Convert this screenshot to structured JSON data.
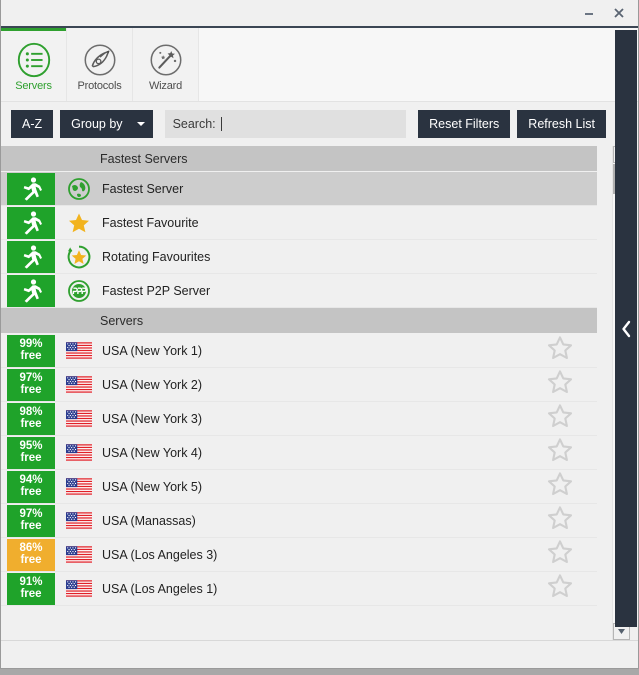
{
  "window": {
    "minimize_label": "minimize-button",
    "close_label": "close-button"
  },
  "tabs": [
    {
      "label": "Servers",
      "icon": "list-circle-icon",
      "active": true
    },
    {
      "label": "Protocols",
      "icon": "protocols-icon",
      "active": false
    },
    {
      "label": "Wizard",
      "icon": "magic-wand-icon",
      "active": false
    }
  ],
  "toolbar": {
    "sort_label": "A-Z",
    "groupby_label": "Group by",
    "search_label": "Search:",
    "search_value": "",
    "search_placeholder": "Search:",
    "reset_label": "Reset Filters",
    "refresh_label": "Refresh List"
  },
  "sections": [
    {
      "header": "Fastest Servers",
      "rows": [
        {
          "badge": "run",
          "badge_color": "green",
          "icon": "globe-icon",
          "label": "Fastest Server",
          "selected": true,
          "star": false
        },
        {
          "badge": "run",
          "badge_color": "green",
          "icon": "star-filled-icon",
          "label": "Fastest Favourite",
          "selected": false,
          "star": false
        },
        {
          "badge": "run",
          "badge_color": "green",
          "icon": "rotating-star-icon",
          "label": "Rotating Favourites",
          "selected": false,
          "star": false
        },
        {
          "badge": "run",
          "badge_color": "green",
          "icon": "p2p-icon",
          "label": "Fastest P2P Server",
          "selected": false,
          "star": false
        }
      ]
    },
    {
      "header": "Servers",
      "rows": [
        {
          "pct": "99%",
          "free": "free",
          "badge_color": "green",
          "icon": "flag-usa-icon",
          "label": "USA (New York 1)",
          "selected": false,
          "star": true
        },
        {
          "pct": "97%",
          "free": "free",
          "badge_color": "green",
          "icon": "flag-usa-icon",
          "label": "USA (New York 2)",
          "selected": false,
          "star": true
        },
        {
          "pct": "98%",
          "free": "free",
          "badge_color": "green",
          "icon": "flag-usa-icon",
          "label": "USA (New York 3)",
          "selected": false,
          "star": true
        },
        {
          "pct": "95%",
          "free": "free",
          "badge_color": "green",
          "icon": "flag-usa-icon",
          "label": "USA (New York 4)",
          "selected": false,
          "star": true
        },
        {
          "pct": "94%",
          "free": "free",
          "badge_color": "green",
          "icon": "flag-usa-icon",
          "label": "USA (New York 5)",
          "selected": false,
          "star": true
        },
        {
          "pct": "97%",
          "free": "free",
          "badge_color": "green",
          "icon": "flag-usa-icon",
          "label": "USA (Manassas)",
          "selected": false,
          "star": true
        },
        {
          "pct": "86%",
          "free": "free",
          "badge_color": "orange",
          "icon": "flag-usa-icon",
          "label": "USA (Los Angeles 3)",
          "selected": false,
          "star": true
        },
        {
          "pct": "91%",
          "free": "free",
          "badge_color": "green",
          "icon": "flag-usa-icon",
          "label": "USA (Los Angeles 1)",
          "selected": false,
          "star": true
        }
      ]
    }
  ],
  "colors": {
    "accent_green": "#2fa02f",
    "badge_green": "#1fa32a",
    "badge_orange": "#f0ae2e",
    "dark_navy": "#2a3340",
    "group_header": "#c4c4c4"
  },
  "flyout": {
    "icon": "chevron-left-icon"
  },
  "scrollbar": {
    "up_icon": "scroll-up-arrow-icon",
    "down_icon": "scroll-down-arrow-icon"
  }
}
